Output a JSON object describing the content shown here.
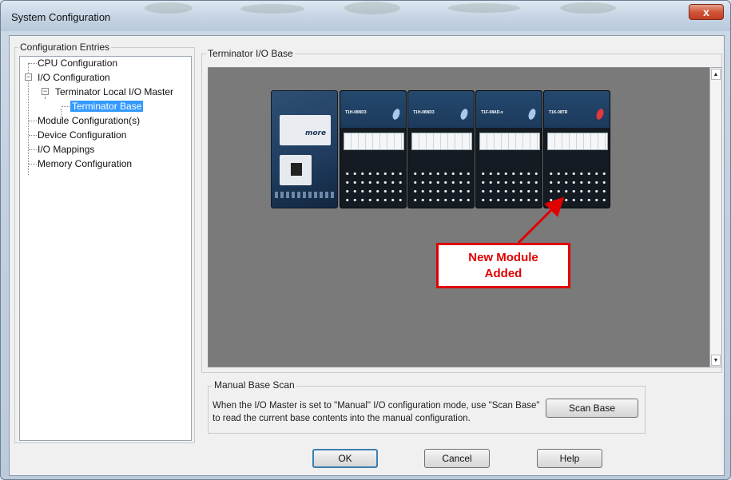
{
  "window": {
    "title": "System Configuration",
    "close_glyph": "x"
  },
  "tree": {
    "group_label": "Configuration Entries",
    "items": [
      {
        "label": "CPU Configuration"
      },
      {
        "label": "I/O Configuration",
        "expander": "−"
      },
      {
        "label": "Terminator Local I/O Master",
        "expander": "−"
      },
      {
        "label": "Terminator Base",
        "selected": true
      },
      {
        "label": "Module Configuration(s)"
      },
      {
        "label": "Device Configuration"
      },
      {
        "label": "I/O Mappings"
      },
      {
        "label": "Memory Configuration"
      }
    ]
  },
  "base": {
    "group_label": "Terminator I/O Base",
    "cpu_logo": "more",
    "modules": [
      {
        "name": "T1H-08ND3",
        "oval_color": "#a8c8ec"
      },
      {
        "name": "T1H-08ND3",
        "oval_color": "#a8c8ec"
      },
      {
        "name": "T1F-08AD-x",
        "oval_color": "#a8c8ec"
      },
      {
        "name": "T1K-08TR",
        "oval_color": "#e23a3a"
      }
    ],
    "callout_line1": "New Module",
    "callout_line2": "Added",
    "callout_color": "#e00000",
    "scroll_up": "▲",
    "scroll_down": "▼"
  },
  "scan": {
    "group_label": "Manual Base Scan",
    "description": "When the I/O Master is set to \"Manual\" I/O configuration mode, use \"Scan Base\" to read the current base contents into the manual configuration.",
    "button_label": "Scan Base"
  },
  "footer": {
    "ok_label": "OK",
    "cancel_label": "Cancel",
    "help_label": "Help"
  }
}
